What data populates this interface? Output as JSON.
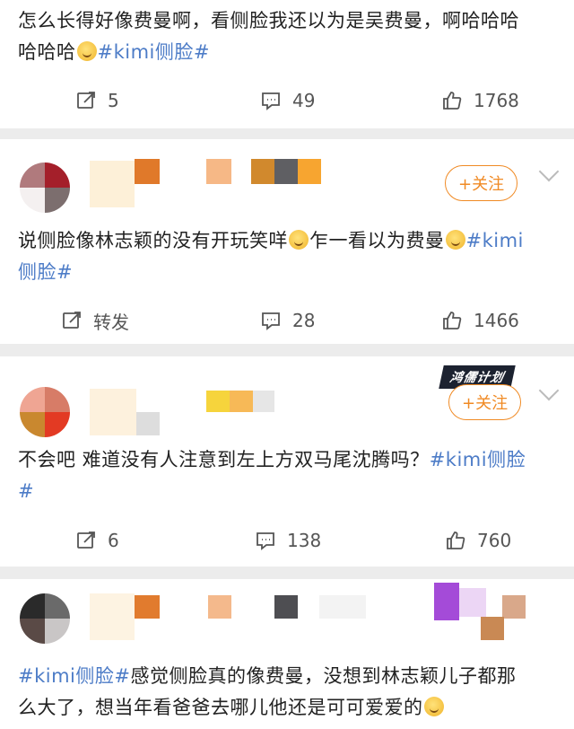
{
  "posts": [
    {
      "text_lines": [
        "怎么长得好像费曼啊，看侧脸我还以为是吴费曼，啊哈哈哈",
        "哈哈哈"
      ],
      "hashtag_inline": "#kimi侧脸#",
      "actions": {
        "repost": "5",
        "comment": "49",
        "like": "1768"
      }
    },
    {
      "text_main": "说侧脸像林志颖的没有开玩笑咩",
      "text_after_emoji": "乍一看以为费曼",
      "hashtag_part1": "#kimi",
      "hashtag_part2": "侧脸#",
      "follow_label": "+关注",
      "actions": {
        "repost": "转发",
        "comment": "28",
        "like": "1466"
      }
    },
    {
      "text_line1": "不会吧 难道没有人注意到左上方双马尾沈腾吗？",
      "hashtag_part1": "#kimi侧脸",
      "hashtag_part2": "#",
      "follow_label": "+关注",
      "watermark": "鸿儒计划",
      "actions": {
        "repost": "6",
        "comment": "138",
        "like": "760"
      }
    },
    {
      "hashtag": "#kimi侧脸#",
      "text_line1": "感觉侧脸真的像费曼，没想到林志颖儿子都那",
      "text_line2": "么大了，想当年看爸爸去哪儿他还是可可爱爱的"
    }
  ],
  "colors": {
    "tag": "#4d7cc7",
    "follow": "#f08a24"
  },
  "icons": {
    "repost": "repost-icon",
    "comment": "comment-icon",
    "like": "thumbs-up-icon"
  }
}
